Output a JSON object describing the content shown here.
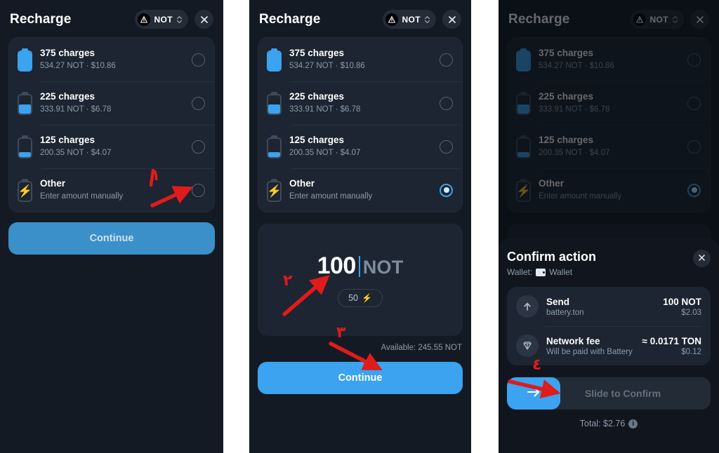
{
  "app": {
    "header": {
      "title": "Recharge",
      "token_label": "NOT",
      "token_icon": "notcoin-logo-icon",
      "chevron_icon": "chevron-updown-icon",
      "close_icon": "close-icon"
    },
    "options": [
      {
        "title": "375 charges",
        "subtitle": "534.27 NOT · $10.86",
        "icon": "battery-full-icon",
        "level": "full",
        "selected": false
      },
      {
        "title": "225 charges",
        "subtitle": "333.91 NOT · $6.78",
        "icon": "battery-mid-icon",
        "level": "mid",
        "selected": false
      },
      {
        "title": "125 charges",
        "subtitle": "200.35 NOT · $4.07",
        "icon": "battery-low-icon",
        "level": "low",
        "selected": false
      },
      {
        "title": "Other",
        "subtitle": "Enter amount manually",
        "icon": "battery-bolt-icon",
        "level": "bolt",
        "selected": false
      }
    ],
    "continue_label": "Continue",
    "amount": {
      "value": "100",
      "currency": "NOT",
      "charges_chip": "50",
      "charges_chip_icon": "bolt-icon",
      "available": "Available: 245.55 NOT"
    },
    "confirm": {
      "title": "Confirm action",
      "wallet_prefix": "Wallet:",
      "wallet_icon": "wallet-icon",
      "wallet_name": "Wallet",
      "close_icon": "close-icon",
      "rows": [
        {
          "icon": "send-arrow-up-icon",
          "title": "Send",
          "subtitle": "battery.ton",
          "amount": "100 NOT",
          "fiat": "$2.03"
        },
        {
          "icon": "ton-diamond-icon",
          "title": "Network fee",
          "subtitle": "Will be paid with Battery",
          "amount": "≈ 0.0171 TON",
          "fiat": "$0.12"
        }
      ],
      "slide_label": "Slide to Confirm",
      "slide_knob_icon": "arrow-right-icon",
      "total_label": "Total: $2.76",
      "total_info_icon": "info-icon"
    }
  },
  "annotations": {
    "color": "#e01b1b",
    "markers": [
      {
        "id": "step-1",
        "numeral": "١",
        "panel": 1,
        "note": "points to Other radio button"
      },
      {
        "id": "step-2",
        "numeral": "٢",
        "panel": 2,
        "note": "points to amount input"
      },
      {
        "id": "step-3",
        "numeral": "٣",
        "panel": 2,
        "note": "points to Continue button"
      },
      {
        "id": "step-4",
        "numeral": "٤",
        "panel": 3,
        "note": "points to Slide to Confirm"
      }
    ]
  },
  "theme": {
    "page_bg": "#141a23",
    "card_bg": "#1c2531",
    "sheet_bg": "#11161e",
    "accent": "#3ba3ef",
    "accent_dim": "#3b90ca",
    "text_primary": "#ffffff",
    "text_secondary": "#8e9bab",
    "bolt_green": "#46e07f"
  }
}
